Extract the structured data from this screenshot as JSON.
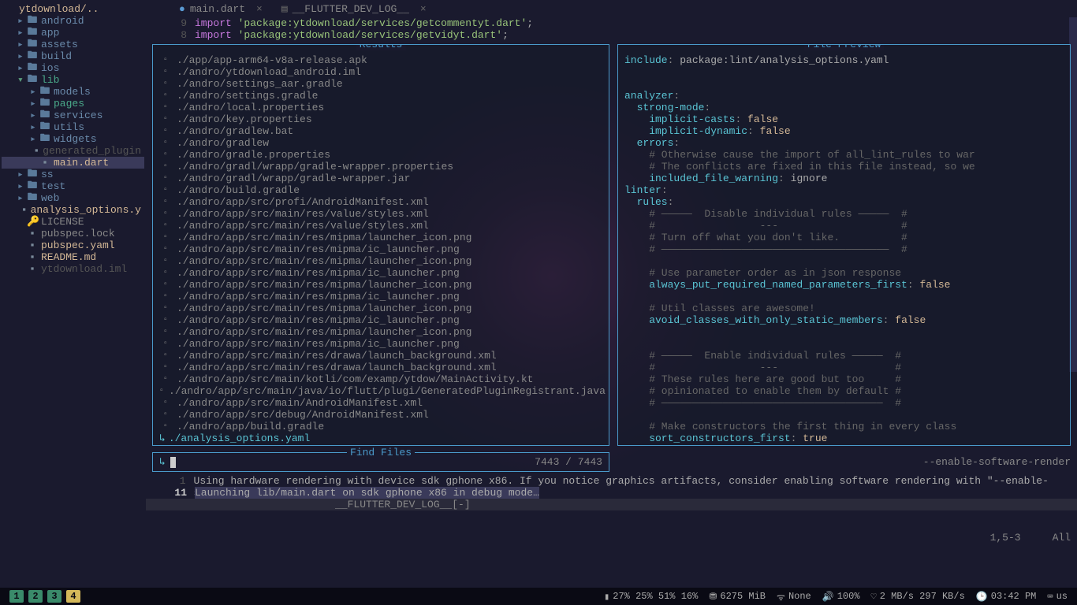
{
  "sidebar": {
    "root": "ytdownload/..",
    "items": [
      {
        "type": "folder",
        "name": "android",
        "indent": 1,
        "exp": false
      },
      {
        "type": "folder",
        "name": "app",
        "indent": 1,
        "exp": false
      },
      {
        "type": "folder",
        "name": "assets",
        "indent": 1,
        "exp": false
      },
      {
        "type": "folder",
        "name": "build",
        "indent": 1,
        "exp": false
      },
      {
        "type": "folder",
        "name": "ios",
        "indent": 1,
        "exp": false
      },
      {
        "type": "folder",
        "name": "lib",
        "indent": 1,
        "exp": true,
        "teal": true
      },
      {
        "type": "folder",
        "name": "models",
        "indent": 2,
        "exp": false
      },
      {
        "type": "folder",
        "name": "pages",
        "indent": 2,
        "exp": false,
        "teal": true
      },
      {
        "type": "folder",
        "name": "services",
        "indent": 2,
        "exp": false
      },
      {
        "type": "folder",
        "name": "utils",
        "indent": 2,
        "exp": false
      },
      {
        "type": "folder",
        "name": "widgets",
        "indent": 2,
        "exp": false
      },
      {
        "type": "file",
        "name": "generated_plugin",
        "indent": 2,
        "dim": true
      },
      {
        "type": "file",
        "name": "main.dart",
        "indent": 2,
        "sel": true,
        "highlight": true
      },
      {
        "type": "folder",
        "name": "ss",
        "indent": 1,
        "exp": false
      },
      {
        "type": "folder",
        "name": "test",
        "indent": 1,
        "exp": false
      },
      {
        "type": "folder",
        "name": "web",
        "indent": 1,
        "exp": false
      },
      {
        "type": "file",
        "name": "analysis_options.y",
        "indent": 1,
        "highlight": true
      },
      {
        "type": "file",
        "name": "LICENSE",
        "indent": 1,
        "icon": "k"
      },
      {
        "type": "file",
        "name": "pubspec.lock",
        "indent": 1
      },
      {
        "type": "file",
        "name": "pubspec.yaml",
        "indent": 1,
        "highlight": true
      },
      {
        "type": "file",
        "name": "README.md",
        "indent": 1,
        "highlight": true
      },
      {
        "type": "file",
        "name": "ytdownload.iml",
        "indent": 1,
        "dim": true
      }
    ]
  },
  "tabs": [
    {
      "label": "main.dart",
      "modified": true
    },
    {
      "label": "__FLUTTER_DEV_LOG__",
      "modified": false
    }
  ],
  "code": [
    {
      "n": "9",
      "kw": "import",
      "str": "'package:ytdownload/services/getcommentyt.dart'"
    },
    {
      "n": "8",
      "kw": "import",
      "str": "'package:ytdownload/services/getvidyt.dart'"
    }
  ],
  "results": {
    "title": "Results",
    "items": [
      "./app/app-arm64-v8a-release.apk",
      "./andro/ytdownload_android.iml",
      "./andro/settings_aar.gradle",
      "./andro/settings.gradle",
      "./andro/local.properties",
      "./andro/key.properties",
      "./andro/gradlew.bat",
      "./andro/gradlew",
      "./andro/gradle.properties",
      "./andro/gradl/wrapp/gradle-wrapper.properties",
      "./andro/gradl/wrapp/gradle-wrapper.jar",
      "./andro/build.gradle",
      "./andro/app/src/profi/AndroidManifest.xml",
      "./andro/app/src/main/res/value/styles.xml",
      "./andro/app/src/main/res/value/styles.xml",
      "./andro/app/src/main/res/mipma/launcher_icon.png",
      "./andro/app/src/main/res/mipma/ic_launcher.png",
      "./andro/app/src/main/res/mipma/launcher_icon.png",
      "./andro/app/src/main/res/mipma/ic_launcher.png",
      "./andro/app/src/main/res/mipma/launcher_icon.png",
      "./andro/app/src/main/res/mipma/ic_launcher.png",
      "./andro/app/src/main/res/mipma/launcher_icon.png",
      "./andro/app/src/main/res/mipma/ic_launcher.png",
      "./andro/app/src/main/res/mipma/launcher_icon.png",
      "./andro/app/src/main/res/mipma/ic_launcher.png",
      "./andro/app/src/main/res/drawa/launch_background.xml",
      "./andro/app/src/main/res/drawa/launch_background.xml",
      "./andro/app/src/main/kotli/com/examp/ytdow/MainActivity.kt",
      "./andro/app/src/main/java/io/flutt/plugi/GeneratedPluginRegistrant.java",
      "./andro/app/src/main/AndroidManifest.xml",
      "./andro/app/src/debug/AndroidManifest.xml",
      "./andro/app/build.gradle"
    ],
    "selected": "./analysis_options.yaml"
  },
  "preview": {
    "title": "File Preview",
    "lines": [
      {
        "t": "kv",
        "k": "include",
        "v": " package:lint/analysis_options.yaml"
      },
      {
        "t": "blank"
      },
      {
        "t": "blank"
      },
      {
        "t": "kv",
        "k": "analyzer",
        "v": ""
      },
      {
        "t": "kv",
        "k": "  strong-mode",
        "v": ""
      },
      {
        "t": "kvb",
        "k": "    implicit-casts",
        "v": "false"
      },
      {
        "t": "kvb",
        "k": "    implicit-dynamic",
        "v": "false"
      },
      {
        "t": "kv",
        "k": "  errors",
        "v": ""
      },
      {
        "t": "c",
        "v": "    # Otherwise cause the import of all_lint_rules to war"
      },
      {
        "t": "c",
        "v": "    # The conflicts are fixed in this file instead, so we"
      },
      {
        "t": "kvv",
        "k": "    included_file_warning",
        "v": "ignore"
      },
      {
        "t": "kv",
        "k": "linter",
        "v": ""
      },
      {
        "t": "kv",
        "k": "  rules",
        "v": ""
      },
      {
        "t": "c",
        "v": "    # —————  Disable individual rules —————  #"
      },
      {
        "t": "c",
        "v": "    #                 ---                    #"
      },
      {
        "t": "c",
        "v": "    # Turn off what you don't like.          #"
      },
      {
        "t": "c",
        "v": "    # —————————————————————————————————————  #"
      },
      {
        "t": "blank"
      },
      {
        "t": "c",
        "v": "    # Use parameter order as in json response"
      },
      {
        "t": "kvb",
        "k": "    always_put_required_named_parameters_first",
        "v": "false"
      },
      {
        "t": "blank"
      },
      {
        "t": "c",
        "v": "    # Util classes are awesome!"
      },
      {
        "t": "kvb",
        "k": "    avoid_classes_with_only_static_members",
        "v": "false"
      },
      {
        "t": "blank"
      },
      {
        "t": "blank"
      },
      {
        "t": "c",
        "v": "    # —————  Enable individual rules —————  #"
      },
      {
        "t": "c",
        "v": "    #                 ---                   #"
      },
      {
        "t": "c",
        "v": "    # These rules here are good but too     #"
      },
      {
        "t": "c",
        "v": "    # opinionated to enable them by default #"
      },
      {
        "t": "c",
        "v": "    # ————————————————————————————————————  #"
      },
      {
        "t": "blank"
      },
      {
        "t": "c",
        "v": "    # Make constructors the first thing in every class"
      },
      {
        "t": "kvb",
        "k": "    sort_constructors_first",
        "v": "true"
      }
    ]
  },
  "find": {
    "title": "Find Files",
    "count": "7443 / 7443"
  },
  "render_hint": "--enable-software-render",
  "log": {
    "lines": [
      {
        "n": "1",
        "text": "Using hardware rendering with device sdk gphone x86. If you notice graphics artifacts, consider enabling software rendering with \"--enable-software-render"
      },
      {
        "n": "11",
        "text": "Launching lib/main.dart on sdk gphone x86 in debug mode…",
        "hl": true,
        "bold": true
      }
    ],
    "status": "__FLUTTER_DEV_LOG__[-]"
  },
  "vim": {
    "pos": "1,5-3",
    "scroll": "All"
  },
  "statusbar": {
    "workspaces": [
      "1",
      "2",
      "3",
      "4"
    ],
    "active_ws": 3,
    "cpu": "27% 25% 51% 16%",
    "mem": "6275 MiB",
    "wifi": "None",
    "vol": "100%",
    "net": "2 MB/s 297 KB/s",
    "time": "03:42 PM",
    "kb": "us"
  }
}
